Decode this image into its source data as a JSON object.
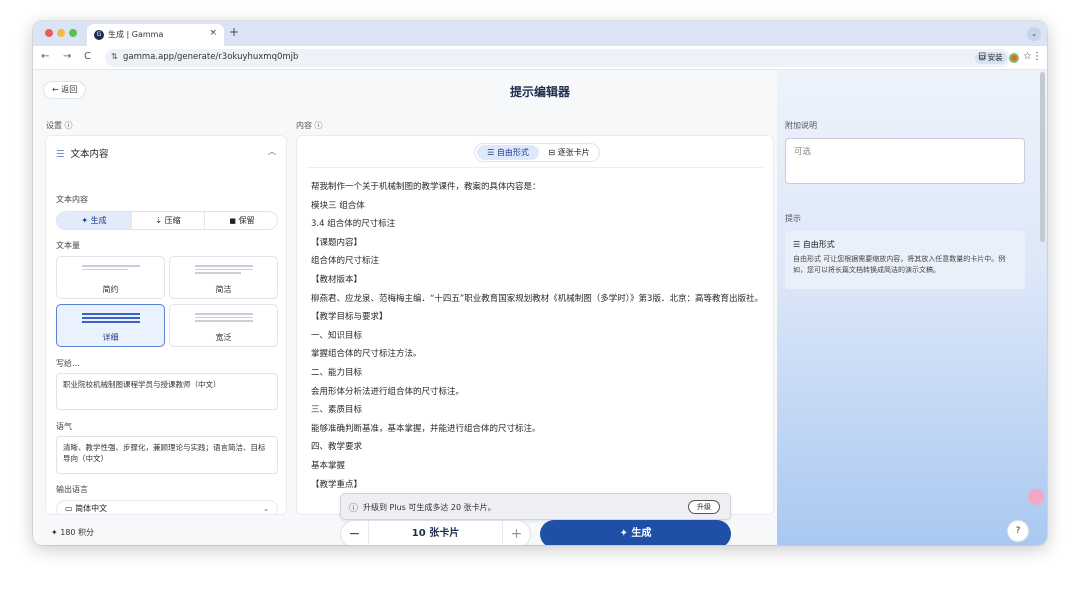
{
  "browser": {
    "tab_title": "生成 | Gamma",
    "tab_favicon": "G",
    "tab_close": "×",
    "new_tab": "+",
    "tab_menu": "⌄",
    "url": "gamma.app/generate/r3okuyhuxmq0mjb",
    "install_label": "安装",
    "nav": {
      "back": "←",
      "forward": "→",
      "reload": "C",
      "site_info": "⇅",
      "star": "☆",
      "extensions": "⊡",
      "menu": "⋮"
    }
  },
  "header": {
    "back_label": "返回",
    "title": "提示编辑器"
  },
  "sections": {
    "settings": "设置 ⓘ",
    "content": "内容 ⓘ",
    "notes": "附加说明"
  },
  "settings": {
    "panel_title": "文本内容",
    "text_content_label": "文本内容",
    "modes": [
      {
        "label": "生成",
        "icon": "✦"
      },
      {
        "label": "压缩",
        "icon": "⇣"
      },
      {
        "label": "保留",
        "icon": "🔒"
      }
    ],
    "active_mode": "生成",
    "amount_label": "文本量",
    "amounts": [
      "简约",
      "简洁",
      "详细",
      "宽泛"
    ],
    "active_amount": "详细",
    "audience_label": "写给...",
    "audience_value": "职业院校机械制图课程学员与授课教师（中文）",
    "tone_label": "语气",
    "tone_value": "清晰、教学性强、步骤化，兼顾理论与实践；语言简洁、目标导向（中文）",
    "language_label": "输出语言",
    "language_value": "简体中文",
    "language_icon": "▭"
  },
  "content": {
    "modes": [
      {
        "label": "自由形式",
        "icon": "☰"
      },
      {
        "label": "逐张卡片",
        "icon": "⊟"
      }
    ],
    "active_mode": "自由形式",
    "lines": [
      "帮我制作一个关于机械制图的教学课件，教案的具体内容是：",
      "模块三 组合体",
      "3.4 组合体的尺寸标注",
      "【课题内容】",
      "组合体的尺寸标注",
      "【教材版本】",
      "柳燕君、应龙泉、范梅梅主编．“十四五”职业教育国家规划教材《机械制图（多学时）》第3版．北京：高等教育出版社。",
      "【教学目标与要求】",
      "一、知识目标",
      "掌握组合体的尺寸标注方法。",
      "二、能力目标",
      "会用形体分析法进行组合体的尺寸标注。",
      "三、素质目标",
      "能够准确判断基准，基本掌握，并能进行组合体的尺寸标注。",
      "四、教学要求",
      "基本掌握",
      "【教学重点】"
    ],
    "toast_icon": "ⓘ",
    "toast_text": "升级到 Plus 可生成多达 20 张卡片。",
    "toast_button": "升级"
  },
  "notes": {
    "placeholder": "可选",
    "tip_label": "提示",
    "tip_title": "☰ 自由形式",
    "tip_body": "自由形式 可让您根据需要缩放内容，将其放入任意数量的卡片中。例如，您可以将长篇文档转换成简洁的演示文稿。"
  },
  "footer": {
    "credits": "✦ 180 积分",
    "card_count": "10 张卡片",
    "minus": "−",
    "plus": "+",
    "generate_label": "✦ 生成",
    "help": "?"
  },
  "colors": {
    "accent": "#1f4fa6",
    "active_bg": "#e3ebfb",
    "right_gradient_bottom": "#a9c8f1"
  }
}
